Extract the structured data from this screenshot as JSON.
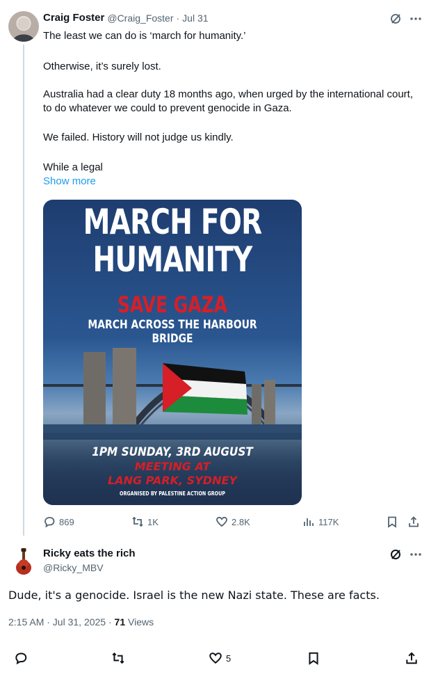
{
  "tweet": {
    "author_name": "Craig Foster",
    "author_handle": "@Craig_Foster",
    "date": "Jul 31",
    "paragraphs": [
      "The least we can do is ‘march for humanity.’",
      "Otherwise, it’s surely lost.",
      "Australia had a clear duty 18 months ago, when urged by the international court, to do whatever we could to prevent genocide in Gaza.",
      "We failed. History will not judge us kindly.",
      "While a legal"
    ],
    "show_more": "Show more",
    "poster": {
      "title_line1": "MARCH FOR",
      "title_line2": "HUMANITY",
      "subtitle": "SAVE GAZA",
      "route": "MARCH ACROSS THE HARBOUR BRIDGE",
      "time": "1PM SUNDAY, 3RD AUGUST",
      "meeting": "MEETING AT",
      "place": "LANG PARK, SYDNEY",
      "organiser": "ORGANISED BY PALESTINE ACTION GROUP"
    },
    "actions": {
      "replies": "869",
      "reposts": "1K",
      "likes": "2.8K",
      "views": "117K"
    }
  },
  "reply": {
    "author_name": "Ricky eats the rich",
    "author_handle": "@Ricky_MBV",
    "text": "Dude, it's a genocide. Israel is the new Nazi state. These are facts.",
    "timestamp": "2:15 AM · Jul 31, 2025 · ",
    "views_count": "71",
    "views_label": "Views",
    "actions": {
      "likes": "5"
    }
  },
  "icons": {
    "grok": "grok-slash-icon",
    "more": "more-dots-icon",
    "reply": "reply-bubble-icon",
    "repost": "repost-arrows-icon",
    "like": "heart-icon",
    "views": "bar-chart-icon",
    "bookmark": "bookmark-icon",
    "share": "share-upload-icon"
  },
  "colors": {
    "link": "#1d9bf0",
    "muted": "#536471",
    "text": "#0f1419",
    "poster_red": "#d61f26"
  }
}
